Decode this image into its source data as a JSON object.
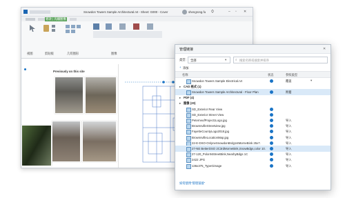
{
  "revit": {
    "title": "Snowdon Towers Sample Architectural.rvt - Sheet: G000 - Cover",
    "user": "shengrong.fu",
    "context_tab": "修改 | 光栅图像",
    "ribbon_labels": [
      "视图",
      "剪贴板",
      "几何图形",
      "图像"
    ],
    "plan_label": "Previously on this site"
  },
  "dialog": {
    "title": "管理链接",
    "filter_label": "类型:",
    "filter_value": "全部",
    "search_placeholder": "搜索名称或搜索并排序",
    "add_button": "添加",
    "columns": {
      "name": "名称",
      "status": "状态",
      "type": "参照类型"
    },
    "rows": [
      {
        "kind": "item",
        "name": "Snowdon Towers Sample Electrical.rvt",
        "status": "ok",
        "type": "覆盖",
        "dropdown": true
      },
      {
        "kind": "group",
        "name": "CAD 格式 (1)"
      },
      {
        "kind": "item",
        "name": "Snowdon Towers Sample Architectural - Floor Plan",
        "status": "ok",
        "type": "附着",
        "selected": true
      },
      {
        "kind": "group",
        "name": "PDF (4)"
      },
      {
        "kind": "group",
        "name": "图像 (20)"
      },
      {
        "kind": "item",
        "name": "SD_Exterior Rear View",
        "status": "ok",
        "type": ""
      },
      {
        "kind": "item",
        "name": "SD_Exterior Street View",
        "status": "ok",
        "type": ""
      },
      {
        "kind": "item",
        "name": "PeterneufProject1Logo.jpg",
        "status": "ok",
        "type": "导入"
      },
      {
        "kind": "item",
        "name": "BrownsvilleStreetview.jpg",
        "status": "ok",
        "type": "导入"
      },
      {
        "kind": "item",
        "name": "FayetteCountyLogo2018.jpg",
        "status": "ok",
        "type": "导入"
      },
      {
        "kind": "item",
        "name": "BrownsvilleLocationMap.jpg",
        "status": "ok",
        "type": "导入"
      },
      {
        "kind": "item",
        "name": "22-E-DSO-OnlyneSnowdonBrdg1stMorneBink 25x7.",
        "status": "ok",
        "type": "导入"
      },
      {
        "kind": "item",
        "name": "27-NE BetterDSO 2C3rdMorneBink,SnowBdgs,color 10.",
        "status": "ok",
        "type": "导入",
        "selected": true
      },
      {
        "kind": "item",
        "name": "27-120_PolonNStreetBink,NearbyBdgs 1C",
        "status": "ok",
        "type": "导入"
      },
      {
        "kind": "item",
        "name": "2422 JPG",
        "status": "ok",
        "type": "导入"
      },
      {
        "kind": "item",
        "name": "136x375_TypeGimage",
        "status": "ok",
        "type": "导入"
      }
    ],
    "footer_link": "如何使用“管理链接”"
  },
  "colors": {
    "accent": "#1a74c6",
    "selection": "#d9e9f8",
    "ribbon_tab_active": "#5aa35a"
  }
}
